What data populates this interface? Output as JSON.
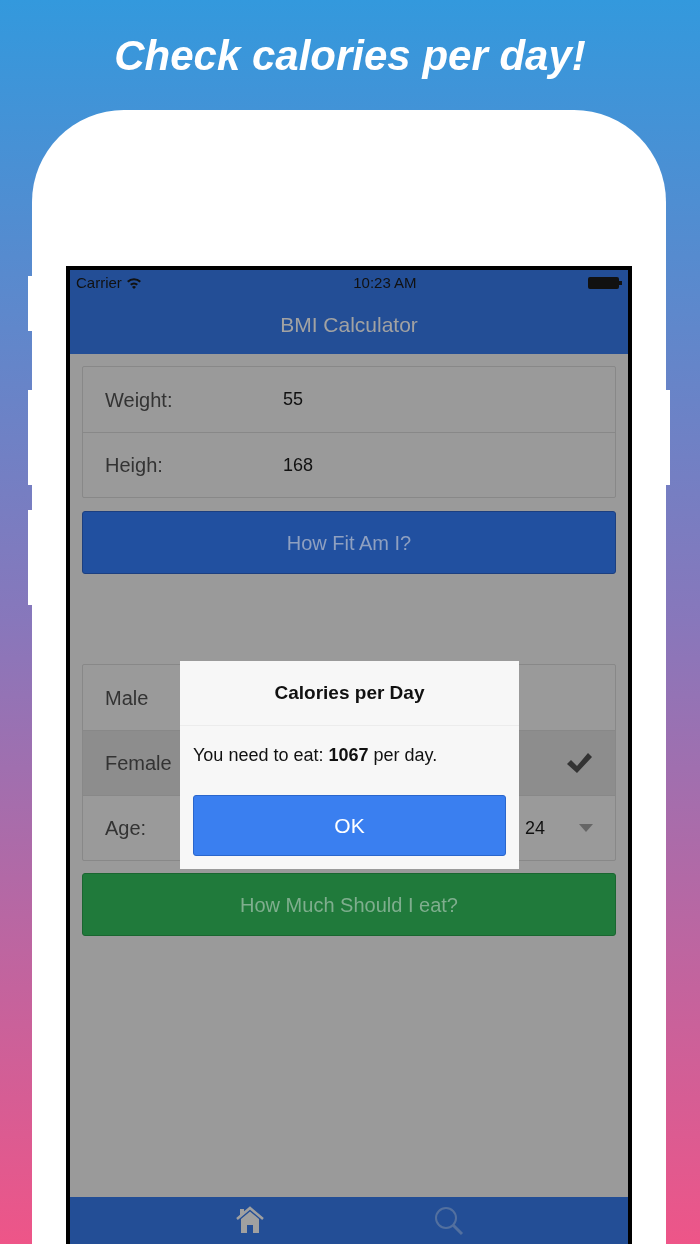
{
  "headline": "Check calories per day!",
  "status_bar": {
    "carrier": "Carrier",
    "time": "10:23 AM"
  },
  "nav": {
    "title": "BMI Calculator"
  },
  "fields": [
    {
      "label": "Weight:",
      "value": "55"
    },
    {
      "label": "Heigh:",
      "value": "168"
    }
  ],
  "fit_button": "How Fit Am I?",
  "genders": [
    {
      "label": "Male",
      "selected": false
    },
    {
      "label": "Female",
      "selected": true
    }
  ],
  "age": {
    "label": "Age:",
    "value": "24"
  },
  "eat_button": "How Much Should I eat?",
  "dialog": {
    "title": "Calories per Day",
    "message": "You need to eat: **1067** per day.",
    "button": "OK"
  },
  "tabs": [
    {
      "kind": "home",
      "selected": true
    },
    {
      "kind": "search",
      "selected": false
    }
  ]
}
